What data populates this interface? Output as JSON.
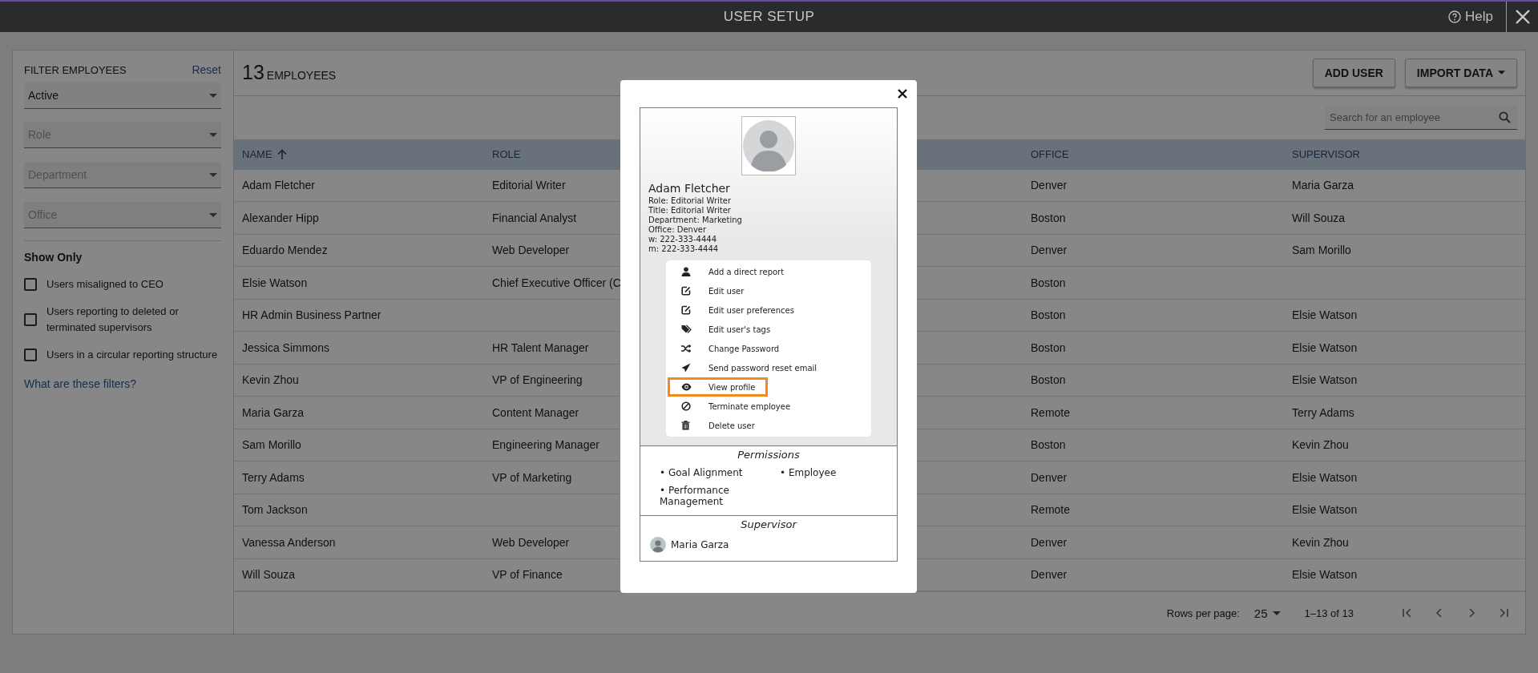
{
  "window": {
    "title": "USER SETUP",
    "help": "Help"
  },
  "filters": {
    "title": "FILTER EMPLOYEES",
    "reset": "Reset",
    "selects": [
      {
        "value": "Active"
      },
      {
        "placeholder": "Role"
      },
      {
        "placeholder": "Department"
      },
      {
        "placeholder": "Office"
      }
    ],
    "show_only": {
      "title": "Show Only",
      "options": [
        {
          "label": "Users misaligned to CEO",
          "checked": false
        },
        {
          "label": "Users reporting to deleted or terminated supervisors",
          "checked": false
        },
        {
          "label": "Users in a circular reporting structure",
          "checked": false
        }
      ]
    },
    "help_link": "What are these filters?"
  },
  "summary": {
    "count": "13",
    "label": "EMPLOYEES"
  },
  "buttons": {
    "add_user": "ADD USER",
    "import_data": "IMPORT DATA"
  },
  "search": {
    "placeholder": "Search for an employee"
  },
  "table": {
    "columns": [
      "NAME",
      "ROLE",
      "OFFICE",
      "SUPERVISOR"
    ],
    "rows": [
      {
        "name": "Adam Fletcher",
        "role": "Editorial Writer",
        "office": "Denver",
        "supervisor": "Maria Garza"
      },
      {
        "name": "Alexander Hipp",
        "role": "Financial Analyst",
        "office": "Boston",
        "supervisor": "Will Souza"
      },
      {
        "name": "Eduardo Mendez",
        "role": "Web Developer",
        "office": "Denver",
        "supervisor": "Sam Morillo"
      },
      {
        "name": "Elsie Watson",
        "role": "Chief Executive Officer (C",
        "office": "Boston"
      },
      {
        "name": "HR Admin Business Partner",
        "office": "Boston",
        "supervisor": "Elsie Watson"
      },
      {
        "name": "Jessica Simmons",
        "role": "HR Talent Manager",
        "office": "Boston",
        "supervisor": "Elsie Watson"
      },
      {
        "name": "Kevin Zhou",
        "role": "VP of Engineering",
        "office": "Boston",
        "supervisor": "Elsie Watson"
      },
      {
        "name": "Maria Garza",
        "role": "Content Manager",
        "office": "Remote",
        "supervisor": "Terry Adams"
      },
      {
        "name": "Sam Morillo",
        "role": "Engineering Manager",
        "office": "Boston",
        "supervisor": "Kevin Zhou"
      },
      {
        "name": "Terry Adams",
        "role": "VP of Marketing",
        "office": "Denver",
        "supervisor": "Elsie Watson"
      },
      {
        "name": "Tom Jackson",
        "office": "Remote",
        "supervisor": "Elsie Watson"
      },
      {
        "name": "Vanessa Anderson",
        "role": "Web Developer",
        "office": "Denver",
        "supervisor": "Kevin Zhou"
      },
      {
        "name": "Will Souza",
        "role": "VP of Finance",
        "office": "Denver",
        "supervisor": "Elsie Watson"
      }
    ]
  },
  "pagination": {
    "rows_per_page_label": "Rows per page:",
    "rows_per_page": "25",
    "range": "1–13 of 13"
  },
  "profile_modal": {
    "name": "Adam Fletcher",
    "details": [
      "Role: Editorial Writer",
      "Title: Editorial Writer",
      "Department: Marketing",
      "Office: Denver",
      "w: 222-333-4444",
      "m: 222-333-4444"
    ],
    "actions": [
      {
        "kind": "person",
        "label": "Add a direct report",
        "highlighted": false
      },
      {
        "kind": "edit",
        "label": "Edit user",
        "highlighted": false
      },
      {
        "kind": "edit",
        "label": "Edit user preferences",
        "highlighted": false
      },
      {
        "kind": "tags",
        "label": "Edit user's tags",
        "highlighted": false
      },
      {
        "kind": "shuffle",
        "label": "Change Password",
        "highlighted": false
      },
      {
        "kind": "send",
        "label": "Send password reset email",
        "highlighted": false
      },
      {
        "kind": "eye",
        "label": "View profile",
        "highlighted": true
      },
      {
        "kind": "ban",
        "label": "Terminate employee",
        "highlighted": false
      },
      {
        "kind": "trash",
        "label": "Delete user",
        "highlighted": false
      }
    ],
    "permissions_title": "Permissions",
    "permissions": [
      "• Goal Alignment",
      "• Employee",
      "• Performance Management"
    ],
    "supervisor_title": "Supervisor",
    "supervisor": "Maria Garza"
  }
}
